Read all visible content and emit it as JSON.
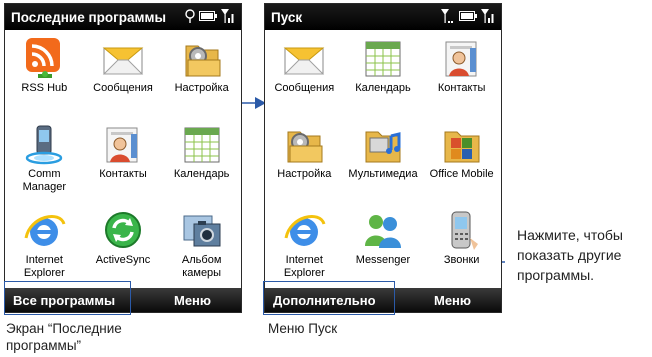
{
  "left_screen": {
    "title": "Последние программы",
    "apps": [
      {
        "label": "RSS Hub",
        "icon": "rss-hub-icon"
      },
      {
        "label": "Сообщения",
        "icon": "envelope-icon"
      },
      {
        "label": "Настройка",
        "icon": "settings-folder-icon"
      },
      {
        "label": "Comm Manager",
        "icon": "comm-manager-icon"
      },
      {
        "label": "Контакты",
        "icon": "contact-card-icon"
      },
      {
        "label": "Календарь",
        "icon": "calendar-icon"
      },
      {
        "label": "Internet Explorer",
        "icon": "internet-explorer-icon"
      },
      {
        "label": "ActiveSync",
        "icon": "activesync-icon"
      },
      {
        "label": "Альбом камеры",
        "icon": "camera-album-icon"
      }
    ],
    "softkey_left": "Все программы",
    "softkey_right": "Меню",
    "caption": "Экран “Последние программы”"
  },
  "right_screen": {
    "title": "Пуск",
    "apps": [
      {
        "label": "Сообщения",
        "icon": "envelope-icon"
      },
      {
        "label": "Календарь",
        "icon": "calendar-icon"
      },
      {
        "label": "Контакты",
        "icon": "contact-card-icon"
      },
      {
        "label": "Настройка",
        "icon": "settings-folder-icon"
      },
      {
        "label": "Мультимедиа",
        "icon": "multimedia-folder-icon"
      },
      {
        "label": "Office Mobile",
        "icon": "office-mobile-icon"
      },
      {
        "label": "Internet Explorer",
        "icon": "internet-explorer-icon"
      },
      {
        "label": "Messenger",
        "icon": "messenger-icon"
      },
      {
        "label": "Звонки",
        "icon": "phone-calls-icon"
      }
    ],
    "softkey_left": "Дополнительно",
    "softkey_right": "Меню",
    "caption": "Меню Пуск"
  },
  "annotation": {
    "text": "Нажмите, чтобы показать другие программы."
  },
  "colors": {
    "bar_dark": "#000000",
    "callout_blue": "#2b5aa8",
    "text_white": "#ffffff"
  }
}
